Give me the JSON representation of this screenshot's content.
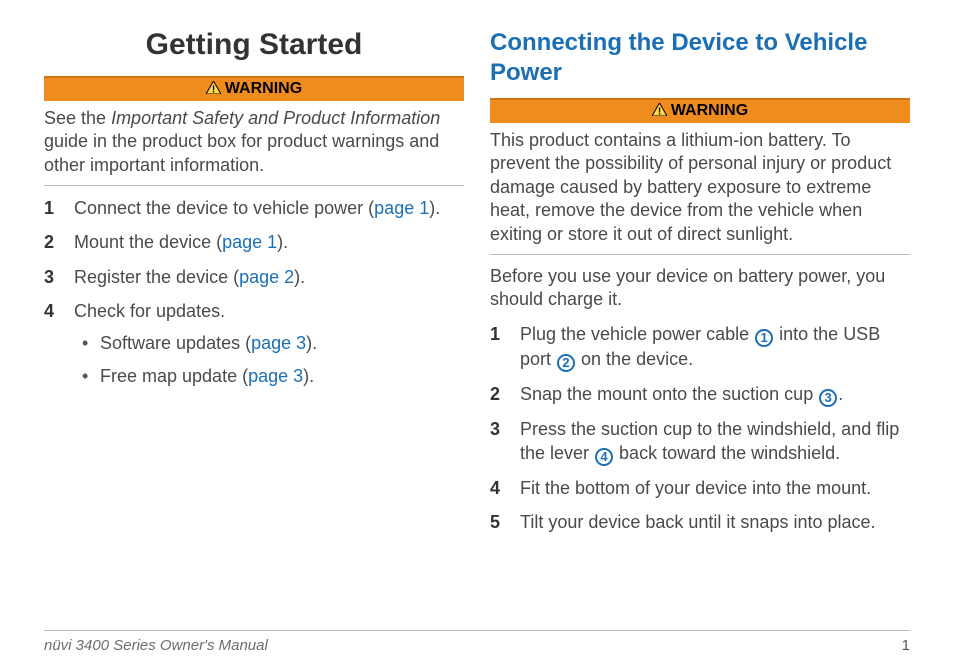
{
  "left": {
    "title": "Getting Started",
    "warning_label": "WARNING",
    "warning_pre": "See the ",
    "warning_em": "Important Safety and Product Information",
    "warning_post": " guide in the product box for product warnings and other important information.",
    "steps": [
      {
        "num": "1",
        "pre": "Connect the device to vehicle power (",
        "link": "page 1",
        "post": ")."
      },
      {
        "num": "2",
        "pre": "Mount the device (",
        "link": "page 1",
        "post": ")."
      },
      {
        "num": "3",
        "pre": "Register the device (",
        "link": "page 2",
        "post": ")."
      },
      {
        "num": "4",
        "pre": "Check for updates.",
        "link": "",
        "post": ""
      }
    ],
    "sub": [
      {
        "pre": "Software updates (",
        "link": "page 3",
        "post": ")."
      },
      {
        "pre": "Free map update (",
        "link": "page 3",
        "post": ")."
      }
    ]
  },
  "right": {
    "section": "Connecting the Device to Vehicle Power",
    "warning_label": "WARNING",
    "warning_body": "This product contains a lithium-ion battery. To prevent the possibility of personal injury or product damage caused by battery exposure to extreme heat, remove the device from the vehicle when exiting or store it out of direct sunlight.",
    "para": "Before you use your device on battery power, you should charge it.",
    "steps": [
      {
        "num": "1",
        "a": "Plug the vehicle power cable ",
        "c1": "1",
        "b": " into the USB port ",
        "c2": "2",
        "c": " on the device."
      },
      {
        "num": "2",
        "a": "Snap the mount onto the suction cup ",
        "c1": "3",
        "b": ".",
        "c2": "",
        "c": ""
      },
      {
        "num": "3",
        "a": "Press the suction cup to the windshield, and flip the lever ",
        "c1": "4",
        "b": " back toward the windshield.",
        "c2": "",
        "c": ""
      },
      {
        "num": "4",
        "a": "Fit the bottom of your device into the mount.",
        "c1": "",
        "b": "",
        "c2": "",
        "c": ""
      },
      {
        "num": "5",
        "a": "Tilt your device back until it snaps into place.",
        "c1": "",
        "b": "",
        "c2": "",
        "c": ""
      }
    ]
  },
  "footer": {
    "text": "nüvi 3400 Series Owner's Manual",
    "page": "1"
  }
}
